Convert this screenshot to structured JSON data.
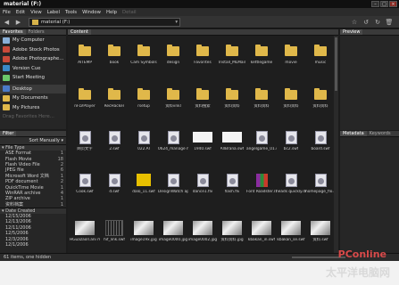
{
  "window": {
    "title": "material (F:)"
  },
  "menu": [
    "File",
    "Edit",
    "View",
    "Label",
    "Tools",
    "Window",
    "Help"
  ],
  "menu_disabled": "Detail",
  "toolbar": {
    "path": "material (F:)"
  },
  "left_top": {
    "tabs": [
      "Favorites",
      "Folders"
    ],
    "items": [
      "My Computer",
      "Adobe Stock Photos",
      "Adobe Photographe...",
      "Version Cue",
      "Start Meeting",
      "Desktop",
      "My Documents",
      "My Pictures",
      "Drag Favorites Here..."
    ]
  },
  "filter": {
    "tab": "Filter",
    "sort": "Sort Manually",
    "file_type": "File Type",
    "types": [
      {
        "name": "ASE Format",
        "count": "1"
      },
      {
        "name": "Flash Movie",
        "count": "18"
      },
      {
        "name": "Flash Video File",
        "count": "2"
      },
      {
        "name": "JPEG file",
        "count": "6"
      },
      {
        "name": "Microsoft Word 文档",
        "count": "1"
      },
      {
        "name": "PDF document",
        "count": "2"
      },
      {
        "name": "QuickTime Movie",
        "count": "1"
      },
      {
        "name": "WinRAR archive",
        "count": "4"
      },
      {
        "name": "ZIP archive",
        "count": "1"
      },
      {
        "name": "资料档案",
        "count": "1"
      }
    ],
    "date_created": "Date Created",
    "dates": [
      "12/15/2006",
      "12/13/2006",
      "12/11/2006",
      "12/5/2006",
      "12/3/2006",
      "12/1/2006"
    ]
  },
  "center": {
    "tab": "Content",
    "rows": [
      [
        {
          "type": "folder",
          "label": "AITEMP"
        },
        {
          "type": "folder",
          "label": "book"
        },
        {
          "type": "folder",
          "label": "Cam Symbols"
        },
        {
          "type": "folder",
          "label": "design"
        },
        {
          "type": "folder",
          "label": "Favorites"
        },
        {
          "type": "folder",
          "label": "Install_MLMail"
        },
        {
          "type": "folder",
          "label": "kettlegame"
        },
        {
          "type": "folder",
          "label": "movie"
        },
        {
          "type": "folder",
          "label": "music"
        }
      ],
      [
        {
          "type": "folder",
          "label": "nFLVPlayer"
        },
        {
          "type": "folder",
          "label": "RecHacker"
        },
        {
          "type": "folder",
          "label": "rsetup"
        },
        {
          "type": "folder",
          "label": "资料vnkl"
        },
        {
          "type": "folder",
          "label": "资料搜索"
        },
        {
          "type": "folder",
          "label": "资料资料"
        },
        {
          "type": "folder",
          "label": "资料资料"
        },
        {
          "type": "folder",
          "label": "资料资料"
        },
        {
          "type": "folder",
          "label": "资料资料"
        }
      ],
      [
        {
          "type": "swf",
          "label": "网页文字"
        },
        {
          "type": "swf",
          "label": "2.swf"
        },
        {
          "type": "swf",
          "label": "022.AI"
        },
        {
          "type": "swf",
          "label": "0624_manage ma.swf"
        },
        {
          "type": "blank",
          "label": "1940.swf"
        },
        {
          "type": "blank",
          "label": "AllBrana.swf"
        },
        {
          "type": "swf",
          "label": "angelgame_01.swf"
        },
        {
          "type": "swf",
          "label": "bc2.swf"
        },
        {
          "type": "swf",
          "label": "board.swf"
        }
      ],
      [
        {
          "type": "swf",
          "label": "Cook.swf"
        },
        {
          "type": "swf",
          "label": "d.swf"
        },
        {
          "type": "yel",
          "label": "dalo_11.swf"
        },
        {
          "type": "swf",
          "label": "DesignWatch ap.swf"
        },
        {
          "type": "swf",
          "label": "dance1.flv"
        },
        {
          "type": "swf",
          "label": "flash.flv"
        },
        {
          "type": "zip",
          "label": "Font Roadster.rar"
        },
        {
          "type": "swf",
          "label": "heads quickly.doc"
        },
        {
          "type": "swf",
          "label": "homepage_flo.swf"
        }
      ],
      [
        {
          "type": "img",
          "label": "HGuazaoll.ani matic.mov"
        },
        {
          "type": "dark",
          "label": "hif_link.swf"
        },
        {
          "type": "img",
          "label": "image19x.jpg"
        },
        {
          "type": "img",
          "label": "image0000.jpg"
        },
        {
          "type": "img",
          "label": "image0002.jpg"
        },
        {
          "type": "img",
          "label": "资料资料.jpg"
        },
        {
          "type": "img",
          "label": "kbakan_in.swf"
        },
        {
          "type": "img",
          "label": "kbakan_se.swf"
        },
        {
          "type": "img",
          "label": "资料.swf"
        }
      ]
    ]
  },
  "right_top": {
    "tabs": [
      "Preview"
    ]
  },
  "right_bot": {
    "tabs": [
      "Metadata",
      "Keywords"
    ]
  },
  "status": {
    "text": "61 items, one hidden"
  },
  "watermark": {
    "text": "PConline",
    "text2": "太平洋电脑网"
  }
}
